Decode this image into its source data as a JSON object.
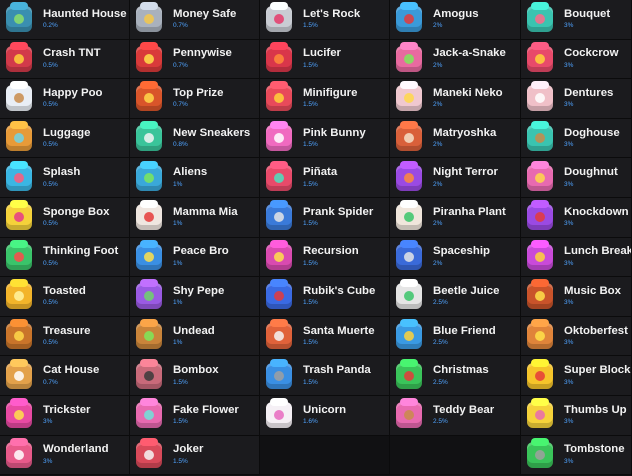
{
  "columns": [
    [
      {
        "name": "Haunted House",
        "odds": "0.2%",
        "color": "#3a8fb0",
        "deco": "#8ee06a",
        "icon": "haunted-house-case-icon"
      },
      {
        "name": "Crash TNT",
        "odds": "0.5%",
        "color": "#d23a4a",
        "deco": "#ffd23a",
        "icon": "crash-tnt-case-icon"
      },
      {
        "name": "Happy Poo",
        "odds": "0.5%",
        "color": "#e9eef5",
        "deco": "#c98b4a",
        "icon": "happy-poo-case-icon"
      },
      {
        "name": "Luggage",
        "odds": "0.5%",
        "color": "#e79a38",
        "deco": "#6fd3e8",
        "icon": "luggage-case-icon"
      },
      {
        "name": "Splash",
        "odds": "0.5%",
        "color": "#3ab6e3",
        "deco": "#ff5a7a",
        "icon": "splash-case-icon"
      },
      {
        "name": "Sponge Box",
        "odds": "0.5%",
        "color": "#f5d23a",
        "deco": "#e53a8a",
        "icon": "sponge-box-case-icon"
      },
      {
        "name": "Thinking Foot",
        "odds": "0.5%",
        "color": "#3ac46a",
        "deco": "#ff4a4a",
        "icon": "thinking-foot-case-icon"
      },
      {
        "name": "Toasted",
        "odds": "0.5%",
        "color": "#f3b42a",
        "deco": "#fff3a0",
        "icon": "toasted-case-icon"
      },
      {
        "name": "Treasure",
        "odds": "0.5%",
        "color": "#c9742a",
        "deco": "#ffd84a",
        "icon": "treasure-case-icon"
      },
      {
        "name": "Cat House",
        "odds": "0.7%",
        "color": "#e3a14a",
        "deco": "#ffffff",
        "icon": "cat-house-case-icon"
      },
      {
        "name": "Trickster",
        "odds": "3%",
        "color": "#e84aa3",
        "deco": "#ffe14a",
        "icon": "trickster-case-icon"
      },
      {
        "name": "Wonderland",
        "odds": "3%",
        "color": "#e85a8a",
        "deco": "#ffffff",
        "icon": "wonderland-case-icon"
      }
    ],
    [
      {
        "name": "Money Safe",
        "odds": "0.7%",
        "color": "#a9b1bd",
        "deco": "#f5c84a",
        "icon": "money-safe-case-icon"
      },
      {
        "name": "Pennywise",
        "odds": "0.7%",
        "color": "#d93a3a",
        "deco": "#ffe14a",
        "icon": "pennywise-case-icon"
      },
      {
        "name": "Top Prize",
        "odds": "0.7%",
        "color": "#d9552a",
        "deco": "#ffd84a",
        "icon": "top-prize-case-icon"
      },
      {
        "name": "New Sneakers",
        "odds": "0.8%",
        "color": "#3ac49a",
        "deco": "#f5f5f5",
        "icon": "new-sneakers-case-icon"
      },
      {
        "name": "Aliens",
        "odds": "1%",
        "color": "#3aa8d9",
        "deco": "#7de85a",
        "icon": "aliens-case-icon"
      },
      {
        "name": "Mamma Mia",
        "odds": "1%",
        "color": "#efe6e0",
        "deco": "#e53a3a",
        "icon": "mamma-mia-case-icon"
      },
      {
        "name": "Peace Bro",
        "odds": "1%",
        "color": "#3a8fe3",
        "deco": "#ffe14a",
        "icon": "peace-bro-case-icon"
      },
      {
        "name": "Shy Pepe",
        "odds": "1%",
        "color": "#9a5ae3",
        "deco": "#6fd36a",
        "icon": "shy-pepe-case-icon"
      },
      {
        "name": "Undead",
        "odds": "1%",
        "color": "#c9843a",
        "deco": "#7de85a",
        "icon": "undead-case-icon"
      },
      {
        "name": "Bombox",
        "odds": "1.5%",
        "color": "#c96a7a",
        "deco": "#3a3a3a",
        "icon": "bombox-case-icon"
      },
      {
        "name": "Fake Flower",
        "odds": "1.5%",
        "color": "#e86ab0",
        "deco": "#6fe3d9",
        "icon": "fake-flower-case-icon"
      },
      {
        "name": "Joker",
        "odds": "1.5%",
        "color": "#d94a5a",
        "deco": "#f5f5f5",
        "icon": "joker-case-icon"
      }
    ],
    [
      {
        "name": "Let's Rock",
        "odds": "1.5%",
        "color": "#c9ccd3",
        "deco": "#e53a6a",
        "icon": "lets-rock-case-icon"
      },
      {
        "name": "Lucifer",
        "odds": "1.5%",
        "color": "#d9364a",
        "deco": "#ff8a3a",
        "icon": "lucifer-case-icon"
      },
      {
        "name": "Minifigure",
        "odds": "1.5%",
        "color": "#e84a5a",
        "deco": "#ffd23a",
        "icon": "minifigure-case-icon"
      },
      {
        "name": "Pink Bunny",
        "odds": "1.5%",
        "color": "#f06ac0",
        "deco": "#ffffff",
        "icon": "pink-bunny-case-icon"
      },
      {
        "name": "Piñata",
        "odds": "1.5%",
        "color": "#e84a6a",
        "deco": "#4ae3c0",
        "icon": "pinata-case-icon"
      },
      {
        "name": "Prank Spider",
        "odds": "1.5%",
        "color": "#3a7ad9",
        "deco": "#e5e5e5",
        "icon": "prank-spider-case-icon"
      },
      {
        "name": "Recursion",
        "odds": "1.5%",
        "color": "#d94ab0",
        "deco": "#ffe14a",
        "icon": "recursion-case-icon"
      },
      {
        "name": "Rubik's Cube",
        "odds": "1.5%",
        "color": "#3a6ae3",
        "deco": "#e53a3a",
        "icon": "rubiks-cube-case-icon"
      },
      {
        "name": "Santa Muerte",
        "odds": "1.5%",
        "color": "#e0623a",
        "deco": "#f5f5f5",
        "icon": "santa-muerte-case-icon"
      },
      {
        "name": "Trash Panda",
        "odds": "1.5%",
        "color": "#3a8fe3",
        "deco": "#a0a0a0",
        "icon": "trash-panda-case-icon"
      },
      {
        "name": "Unicorn",
        "odds": "1.6%",
        "color": "#f5f0f5",
        "deco": "#e86ac0",
        "icon": "unicorn-case-icon"
      }
    ],
    [
      {
        "name": "Amogus",
        "odds": "2%",
        "color": "#3a9ad9",
        "deco": "#e53a3a",
        "icon": "amogus-case-icon"
      },
      {
        "name": "Jack-a-Snake",
        "odds": "2%",
        "color": "#e86aa0",
        "deco": "#7de85a",
        "icon": "jack-a-snake-case-icon"
      },
      {
        "name": "Maneki Neko",
        "odds": "2%",
        "color": "#f0c8d0",
        "deco": "#ffd84a",
        "icon": "maneki-neko-case-icon"
      },
      {
        "name": "Matryoshka",
        "odds": "2%",
        "color": "#d9603a",
        "deco": "#f5e0c8",
        "icon": "matryoshka-case-icon"
      },
      {
        "name": "Night Terror",
        "odds": "2%",
        "color": "#9a4ae3",
        "deco": "#ff8a3a",
        "icon": "night-terror-case-icon"
      },
      {
        "name": "Piranha Plant",
        "odds": "2%",
        "color": "#f0e6dc",
        "deco": "#3ac46a",
        "icon": "piranha-plant-case-icon"
      },
      {
        "name": "Spaceship",
        "odds": "2%",
        "color": "#3a6ad9",
        "deco": "#e5e5e5",
        "icon": "spaceship-case-icon"
      },
      {
        "name": "Beetle Juice",
        "odds": "2.5%",
        "color": "#e5e5e5",
        "deco": "#3ac46a",
        "icon": "beetle-juice-case-icon"
      },
      {
        "name": "Blue Friend",
        "odds": "2.5%",
        "color": "#3a9ae3",
        "deco": "#ffd23a",
        "icon": "blue-friend-case-icon"
      },
      {
        "name": "Christmas",
        "odds": "2.5%",
        "color": "#3ac45a",
        "deco": "#e53a3a",
        "icon": "christmas-case-icon"
      },
      {
        "name": "Teddy Bear",
        "odds": "2.5%",
        "color": "#e86ab0",
        "deco": "#c98b4a",
        "icon": "teddy-bear-case-icon"
      }
    ],
    [
      {
        "name": "Bouquet",
        "odds": "3%",
        "color": "#3ac4b0",
        "deco": "#ff6a8a",
        "icon": "bouquet-case-icon"
      },
      {
        "name": "Cockcrow",
        "odds": "3%",
        "color": "#e84a6a",
        "deco": "#ffd23a",
        "icon": "cockcrow-case-icon"
      },
      {
        "name": "Dentures",
        "odds": "3%",
        "color": "#f0c0c8",
        "deco": "#ffffff",
        "icon": "dentures-case-icon"
      },
      {
        "name": "Doghouse",
        "odds": "3%",
        "color": "#3ac4b0",
        "deco": "#c98b4a",
        "icon": "doghouse-case-icon"
      },
      {
        "name": "Doughnut",
        "odds": "3%",
        "color": "#e86ab0",
        "deco": "#ffd84a",
        "icon": "doughnut-case-icon"
      },
      {
        "name": "Knockdown",
        "odds": "3%",
        "color": "#9a4ae3",
        "deco": "#e53a3a",
        "icon": "knockdown-case-icon"
      },
      {
        "name": "Lunch Break",
        "odds": "3%",
        "color": "#c94ad9",
        "deco": "#ffd23a",
        "icon": "lunch-break-case-icon"
      },
      {
        "name": "Music Box",
        "odds": "3%",
        "color": "#c9532a",
        "deco": "#ffe14a",
        "icon": "music-box-case-icon"
      },
      {
        "name": "Oktoberfest",
        "odds": "3%",
        "color": "#e0843a",
        "deco": "#ffe14a",
        "icon": "oktoberfest-case-icon"
      },
      {
        "name": "Super Block",
        "odds": "3%",
        "color": "#f5c42a",
        "deco": "#e53a3a",
        "icon": "super-block-case-icon"
      },
      {
        "name": "Thumbs Up",
        "odds": "3%",
        "color": "#f5d23a",
        "deco": "#e86ab0",
        "icon": "thumbs-up-case-icon"
      },
      {
        "name": "Tombstone",
        "odds": "3%",
        "color": "#3ac45a",
        "deco": "#a0a0a0",
        "icon": "tombstone-case-icon"
      }
    ]
  ]
}
